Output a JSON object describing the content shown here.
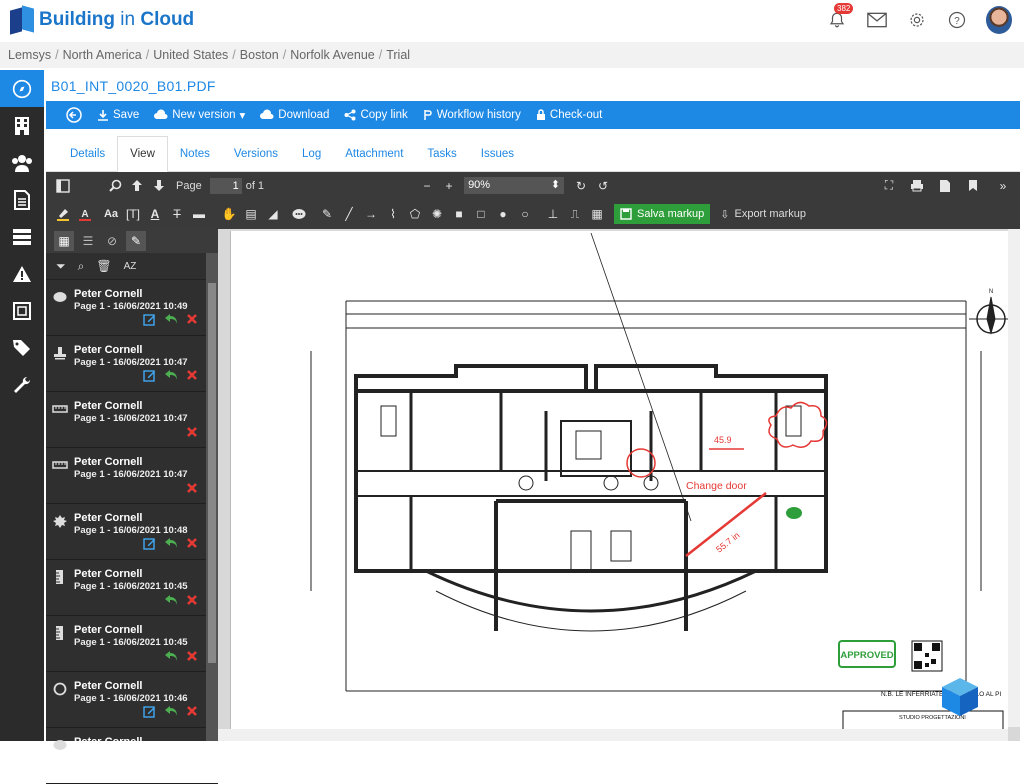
{
  "app": {
    "brand_main": "Building",
    "brand_in": " in ",
    "brand_cloud": "Cloud",
    "notifications_count": "382"
  },
  "breadcrumb": [
    "Lemsys",
    "North America",
    "United States",
    "Boston",
    "Norfolk Avenue",
    "Trial"
  ],
  "document": {
    "title": "B01_INT_0020_B01.PDF"
  },
  "actions": {
    "save": "Save",
    "new_version": "New version",
    "download": "Download",
    "copy_link": "Copy link",
    "workflow_history": "Workflow history",
    "check_out": "Check-out"
  },
  "tabs": [
    "Details",
    "View",
    "Notes",
    "Versions",
    "Log",
    "Attachment",
    "Tasks",
    "Issues"
  ],
  "viewer": {
    "page_label": "Page",
    "page_value": "1",
    "page_of": "of 1",
    "zoom_value": "90%",
    "text_tool": "Aa",
    "save_markup": "Salva markup",
    "export_markup": "Export markup"
  },
  "annotations": [
    {
      "icon": "comment-icon",
      "author": "Peter Cornell",
      "meta": "Page 1 - 16/06/2021 10:49",
      "edit": true,
      "reply": true,
      "delete": true
    },
    {
      "icon": "stamp-icon",
      "author": "Peter Cornell",
      "meta": "Page 1 - 16/06/2021 10:47",
      "edit": true,
      "reply": true,
      "delete": true
    },
    {
      "icon": "measure-icon",
      "author": "Peter Cornell",
      "meta": "Page 1 - 16/06/2021 10:47",
      "edit": false,
      "reply": false,
      "delete": true
    },
    {
      "icon": "measure-icon",
      "author": "Peter Cornell",
      "meta": "Page 1 - 16/06/2021 10:47",
      "edit": false,
      "reply": false,
      "delete": true
    },
    {
      "icon": "cloud-icon",
      "author": "Peter Cornell",
      "meta": "Page 1 - 16/06/2021 10:48",
      "edit": true,
      "reply": true,
      "delete": true
    },
    {
      "icon": "ruler-icon",
      "author": "Peter Cornell",
      "meta": "Page 1 - 16/06/2021 10:45",
      "edit": false,
      "reply": true,
      "delete": true
    },
    {
      "icon": "ruler-icon",
      "author": "Peter Cornell",
      "meta": "Page 1 - 16/06/2021 10:45",
      "edit": false,
      "reply": true,
      "delete": true
    },
    {
      "icon": "circle-icon",
      "author": "Peter Cornell",
      "meta": "Page 1 - 16/06/2021 10:46",
      "edit": true,
      "reply": true,
      "delete": true
    },
    {
      "icon": "comment-icon",
      "author": "Peter Cornell",
      "meta": "",
      "edit": false,
      "reply": false,
      "delete": false
    }
  ],
  "drawing": {
    "markup_text": "Change door",
    "measure_text_1": "55.7 in",
    "measure_text_2": "45.9",
    "stamp": "APPROVED",
    "footer_note": "N.B. LE INFERRIATE SONO SOLO AL PI",
    "title_block": "STUDIO PROGETTAZIONI"
  },
  "colors": {
    "accent": "#1e88e5",
    "toolbar": "#3a3a3a",
    "nav": "#2b2b2b",
    "markup": "#e53935",
    "approved": "#2e9e3a"
  }
}
